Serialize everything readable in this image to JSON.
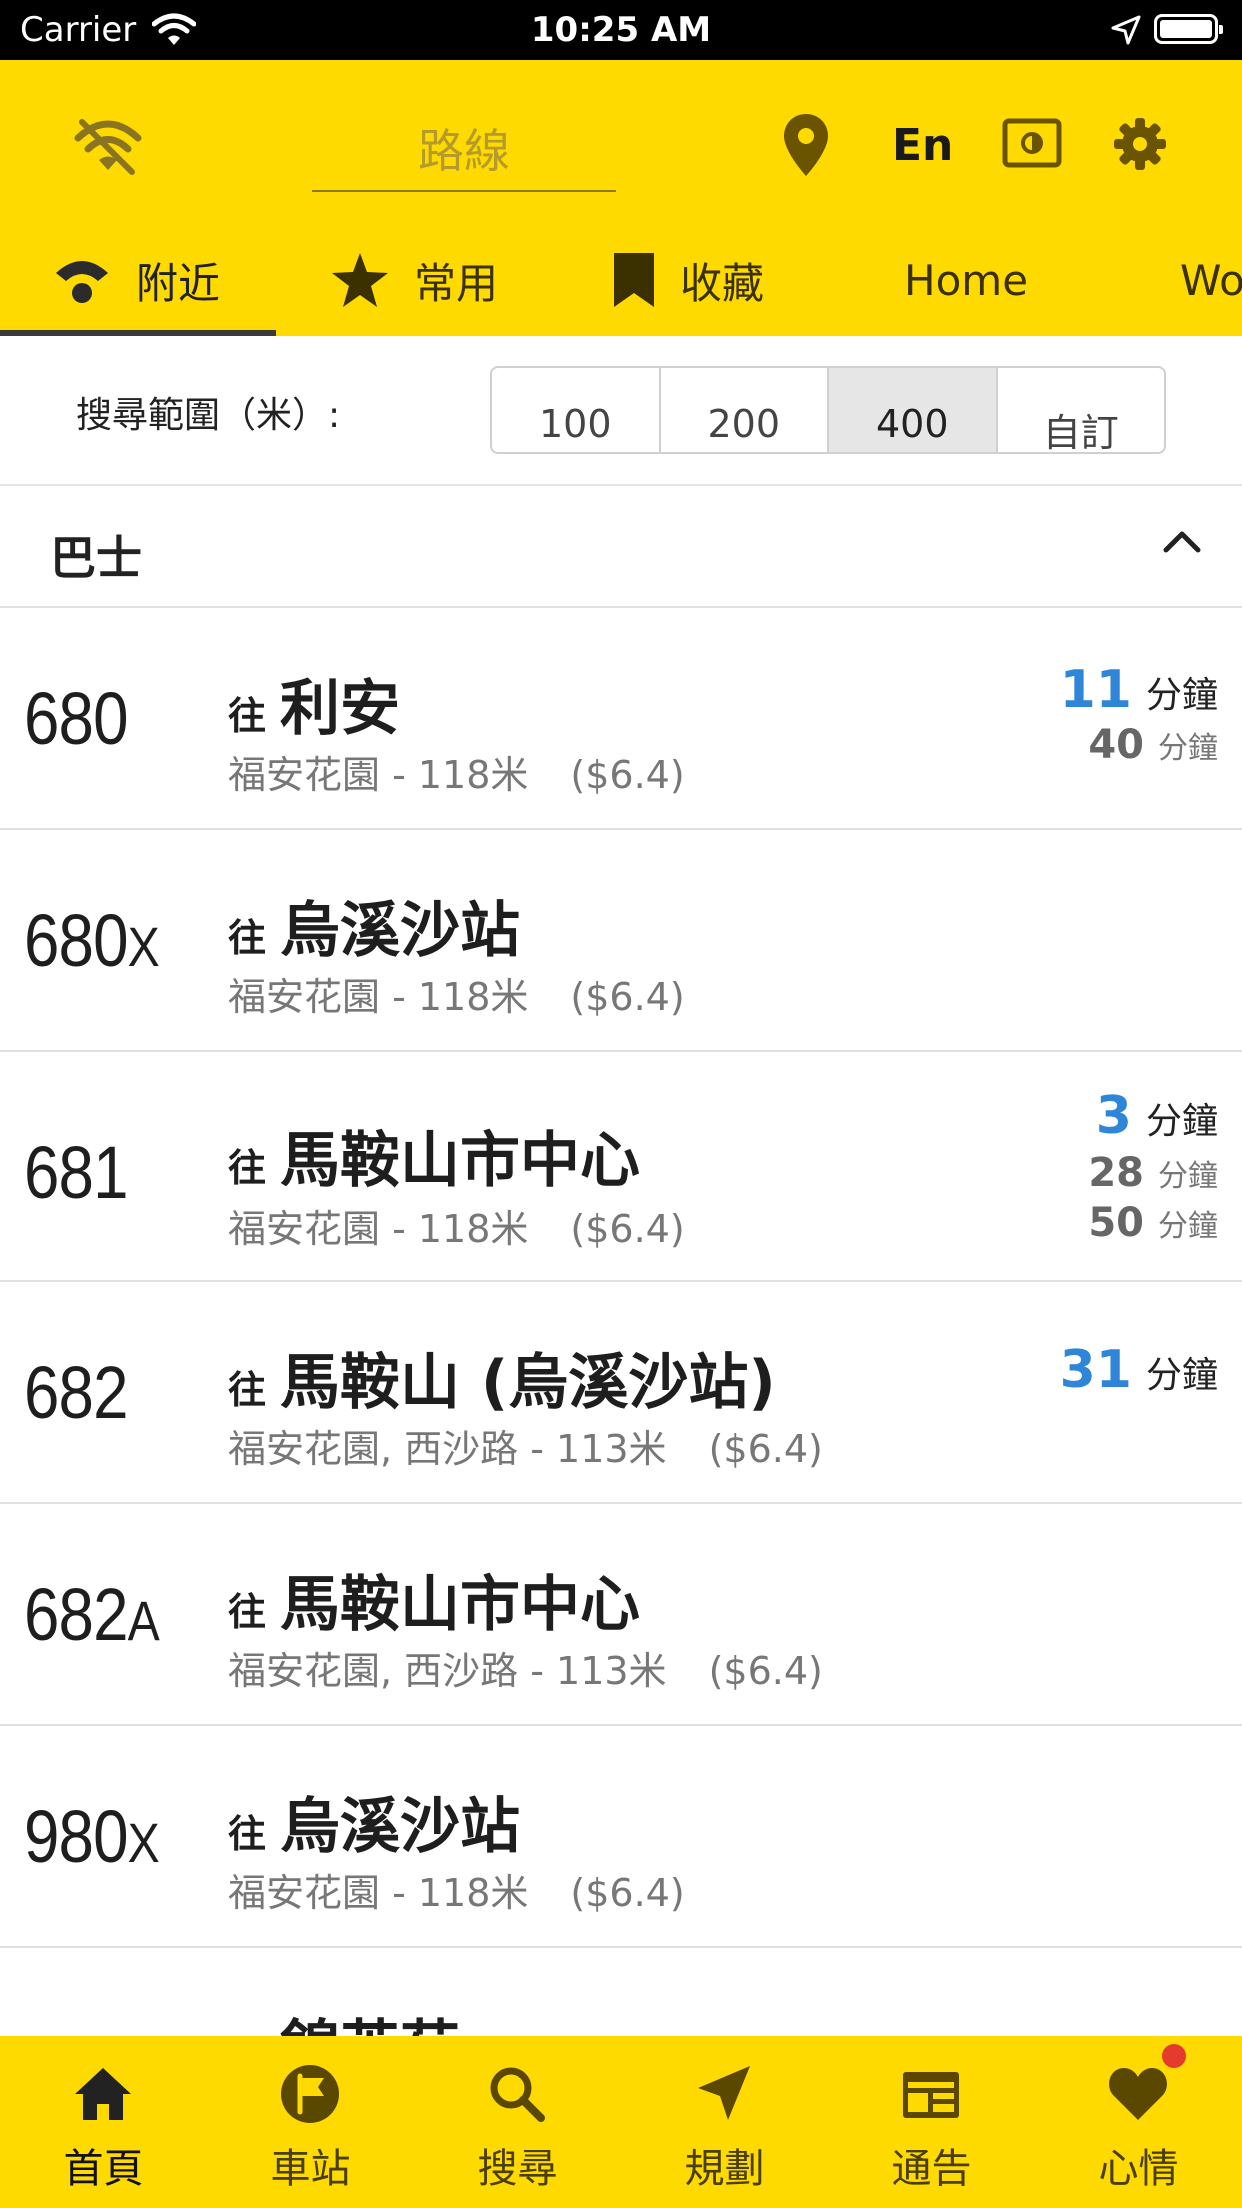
{
  "status_bar": {
    "carrier": "Carrier",
    "time": "10:25 AM"
  },
  "header": {
    "route_placeholder": "路線",
    "lang_label": "En",
    "icons": [
      "wifi-off-icon",
      "location-pin-icon",
      "brightness-icon",
      "gear-icon"
    ]
  },
  "tabs": [
    {
      "label": "附近",
      "icon": "nearby-icon",
      "active": true
    },
    {
      "label": "常用",
      "icon": "star-icon"
    },
    {
      "label": "收藏",
      "icon": "bookmark-icon"
    },
    {
      "label": "Home"
    },
    {
      "label": "Wo"
    }
  ],
  "search_range": {
    "label": "搜尋範圍（米）:",
    "options": [
      "100",
      "200",
      "400",
      "自訂"
    ],
    "selected": "400"
  },
  "section": {
    "title": "巴士"
  },
  "routes": [
    {
      "number": "680",
      "suffix": "",
      "to": "往",
      "destination": "利安",
      "stop": "福安花園 - 118米",
      "fare": "($6.4)",
      "etas": [
        {
          "value": "11",
          "unit": "分鐘"
        },
        {
          "value": "40",
          "unit": "分鐘"
        }
      ]
    },
    {
      "number": "680",
      "suffix": "X",
      "to": "往",
      "destination": "烏溪沙站",
      "stop": "福安花園 - 118米",
      "fare": "($6.4)",
      "etas": []
    },
    {
      "number": "681",
      "suffix": "",
      "to": "往",
      "destination": "馬鞍山市中心",
      "stop": "福安花園 - 118米",
      "fare": "($6.4)",
      "etas": [
        {
          "value": "3",
          "unit": "分鐘"
        },
        {
          "value": "28",
          "unit": "分鐘"
        },
        {
          "value": "50",
          "unit": "分鐘"
        }
      ]
    },
    {
      "number": "682",
      "suffix": "",
      "to": "往",
      "destination": "馬鞍山 (烏溪沙站)",
      "stop": "福安花園, 西沙路 - 113米",
      "fare": "($6.4)",
      "etas": [
        {
          "value": "31",
          "unit": "分鐘"
        }
      ]
    },
    {
      "number": "682",
      "suffix": "A",
      "to": "往",
      "destination": "馬鞍山市中心",
      "stop": "福安花園, 西沙路 - 113米",
      "fare": "($6.4)",
      "etas": []
    },
    {
      "number": "980",
      "suffix": "X",
      "to": "往",
      "destination": "烏溪沙站",
      "stop": "福安花園 - 118米",
      "fare": "($6.4)",
      "etas": []
    },
    {
      "number": "",
      "suffix": "",
      "to": "往",
      "destination": "錦英苑",
      "stop": "",
      "fare": "",
      "etas": []
    }
  ],
  "bottom_tabs": [
    {
      "label": "首頁",
      "icon": "home-icon",
      "active": true
    },
    {
      "label": "車站",
      "icon": "bus-stop-flag-icon"
    },
    {
      "label": "搜尋",
      "icon": "search-icon"
    },
    {
      "label": "規劃",
      "icon": "navigate-arrow-icon"
    },
    {
      "label": "通告",
      "icon": "notice-board-icon"
    },
    {
      "label": "心情",
      "icon": "heart-icon",
      "badge": true
    }
  ],
  "colors": {
    "brand_yellow": "#FFDA00",
    "eta_blue": "#2f86d8",
    "badge_red": "#e53b2e"
  }
}
